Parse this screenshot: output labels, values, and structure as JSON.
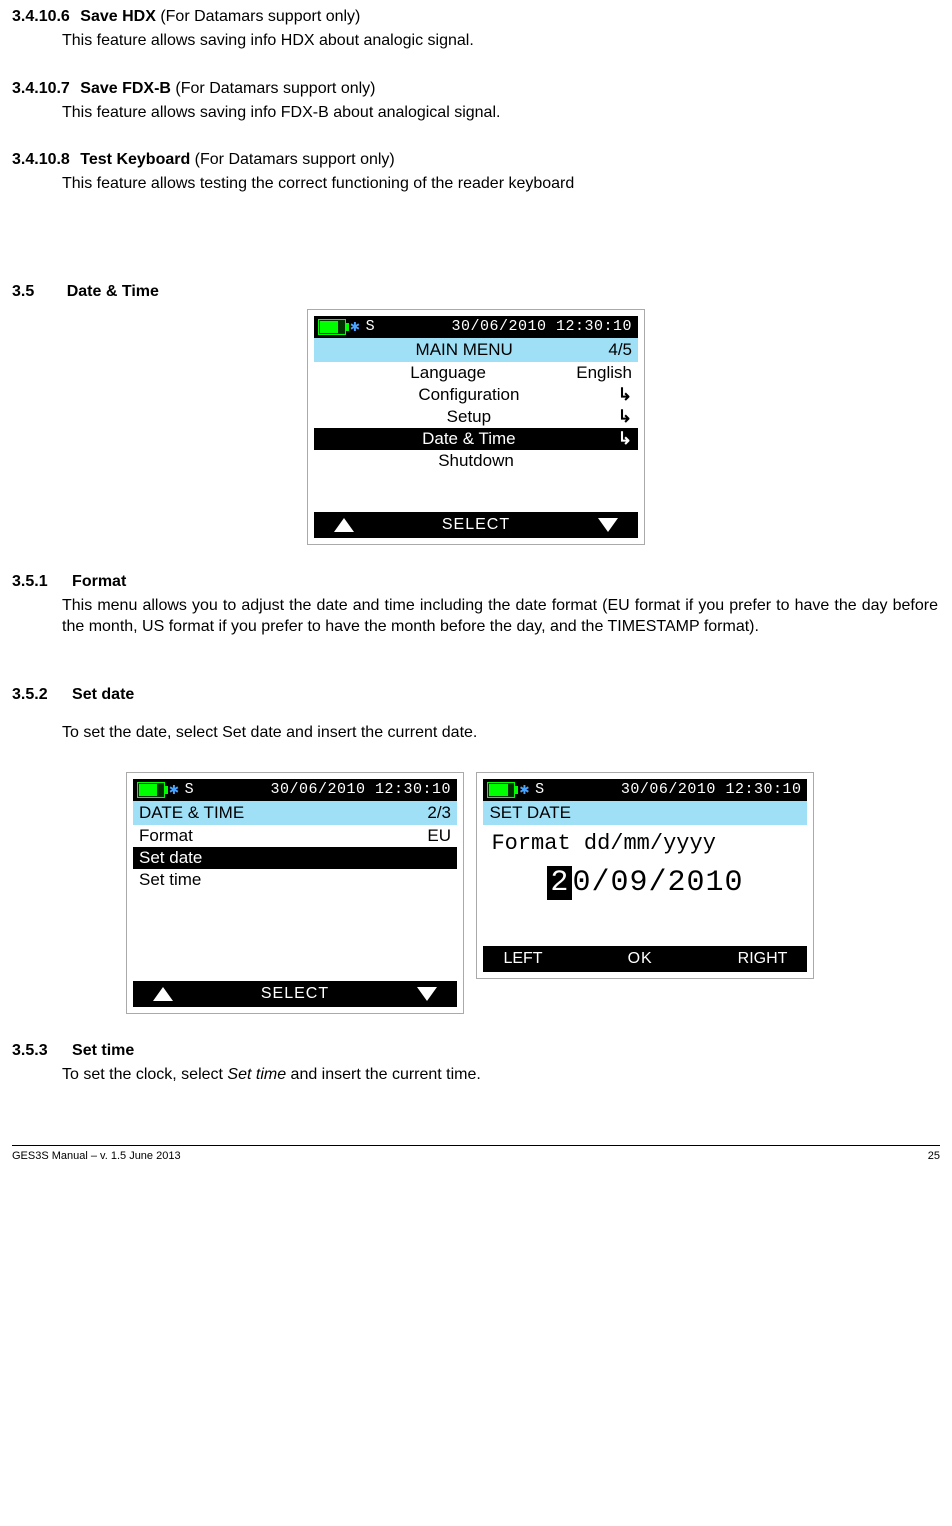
{
  "s1": {
    "num": "3.4.10.6",
    "title": "Save HDX",
    "note": " (For Datamars support only)",
    "body": "This feature allows saving info HDX about analogic signal."
  },
  "s2": {
    "num": "3.4.10.7",
    "title": "Save FDX-B",
    "note": " (For Datamars support only)",
    "body": "This feature allows saving info FDX-B about analogical signal."
  },
  "s3": {
    "num": "3.4.10.8",
    "title": "Test Keyboard",
    "note": " (For Datamars support only)",
    "body": "This feature allows testing the correct functioning of the reader keyboard"
  },
  "s4": {
    "num": "3.5",
    "title": "Date & Time"
  },
  "s5": {
    "num": "3.5.1",
    "title": "Format",
    "body": "This menu allows you to adjust the date and time including the date format (EU format if you prefer to have the day before the month, US format if you prefer to have the month before the day, and the TIMESTAMP format)."
  },
  "s6": {
    "num": "3.5.2",
    "title": "Set date",
    "body": "To set the date, select Set date and insert the current date."
  },
  "s7": {
    "num": "3.5.3",
    "title": "Set time",
    "body_pre": "To set the clock, select ",
    "body_it": "Set time",
    "body_post": " and insert the current time."
  },
  "dev_status": {
    "s": "S",
    "datetime": "30/06/2010  12:30:10"
  },
  "dev1": {
    "title": "MAIN MENU",
    "page": "4/5",
    "items": [
      {
        "label": "Language",
        "right": "English",
        "sel": false,
        "arrow": false
      },
      {
        "label": "Configuration",
        "right": "",
        "sel": false,
        "arrow": true
      },
      {
        "label": "Setup",
        "right": "",
        "sel": false,
        "arrow": true
      },
      {
        "label": "Date & Time",
        "right": "",
        "sel": true,
        "arrow": true
      },
      {
        "label": "Shutdown",
        "right": "",
        "sel": false,
        "arrow": false
      }
    ],
    "bottom_mid": "SELECT"
  },
  "dev2": {
    "title": "DATE & TIME",
    "page": "2/3",
    "items": [
      {
        "label": "Format",
        "right": "EU",
        "sel": false
      },
      {
        "label": "Set date",
        "right": "",
        "sel": true
      },
      {
        "label": "Set time",
        "right": "",
        "sel": false
      }
    ],
    "bottom_mid": "SELECT"
  },
  "dev3": {
    "title": "SET DATE",
    "format_line": "Format dd/mm/yyyy",
    "date_sel": "2",
    "date_rest": "0/09/2010",
    "bottom_left": "LEFT",
    "bottom_mid": "OK",
    "bottom_right": "RIGHT"
  },
  "footer": {
    "left": "GES3S Manual – v. 1.5  June 2013",
    "right": "25"
  }
}
